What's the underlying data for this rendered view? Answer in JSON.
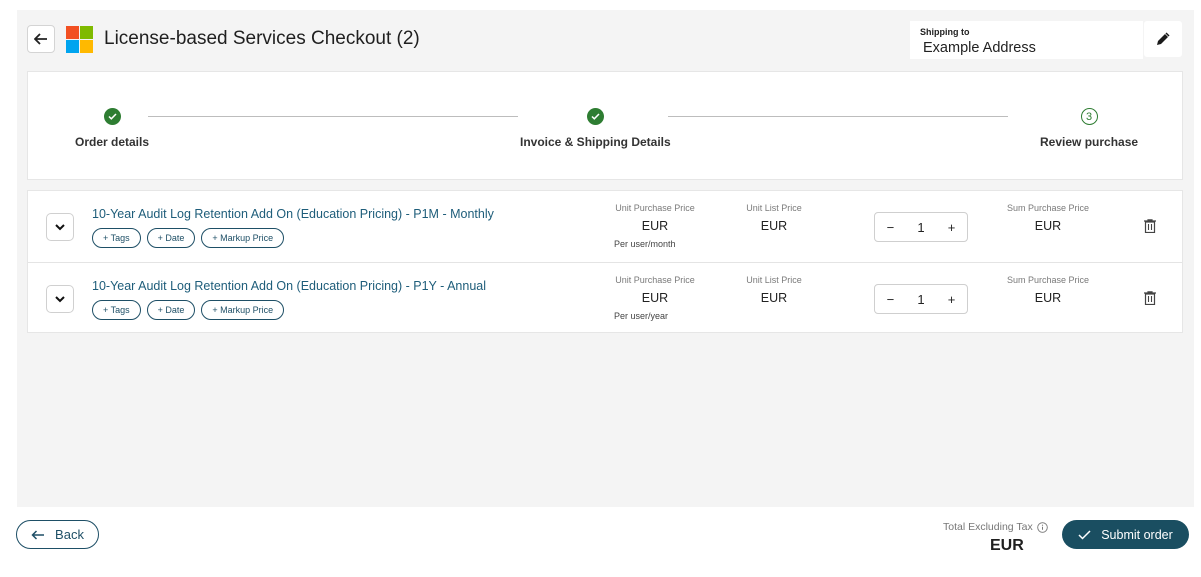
{
  "header": {
    "title": "License-based Services Checkout (2)",
    "back_icon": "arrow-left-icon",
    "logo_colors": [
      "#f25022",
      "#7fba00",
      "#00a4ef",
      "#ffb900"
    ],
    "shipping_label": "Shipping to",
    "shipping_value": "Example Address",
    "edit_icon": "pencil-icon"
  },
  "stepper": {
    "steps": [
      {
        "label": "Order details",
        "state": "done"
      },
      {
        "label": "Invoice & Shipping Details",
        "state": "done"
      },
      {
        "label": "Review purchase",
        "state": "current",
        "number": "3"
      }
    ],
    "accent": "#2e7d32"
  },
  "items": [
    {
      "title": "10-Year Audit Log Retention Add On (Education Pricing) - P1M - Monthly",
      "chips": [
        "+ Tags",
        "+ Date",
        "+ Markup Price"
      ],
      "unit_purchase_label": "Unit Purchase Price",
      "unit_purchase_value": "EUR",
      "unit_purchase_sub": "Per user/month",
      "unit_list_label": "Unit List Price",
      "unit_list_value": "EUR",
      "qty_minus": "−",
      "qty": "1",
      "qty_plus": "+",
      "sum_label": "Sum Purchase Price",
      "sum_value": "EUR"
    },
    {
      "title": "10-Year Audit Log Retention Add On (Education Pricing) - P1Y - Annual",
      "chips": [
        "+ Tags",
        "+ Date",
        "+ Markup Price"
      ],
      "unit_purchase_label": "Unit Purchase Price",
      "unit_purchase_value": "EUR",
      "unit_purchase_sub": "Per user/year",
      "unit_list_label": "Unit List Price",
      "unit_list_value": "EUR",
      "qty_minus": "−",
      "qty": "1",
      "qty_plus": "+",
      "sum_label": "Sum Purchase Price",
      "sum_value": "EUR"
    }
  ],
  "footer": {
    "back_label": "Back",
    "total_label": "Total Excluding Tax",
    "total_value": "EUR",
    "submit_label": "Submit order",
    "primary_color": "#1a4e61"
  }
}
